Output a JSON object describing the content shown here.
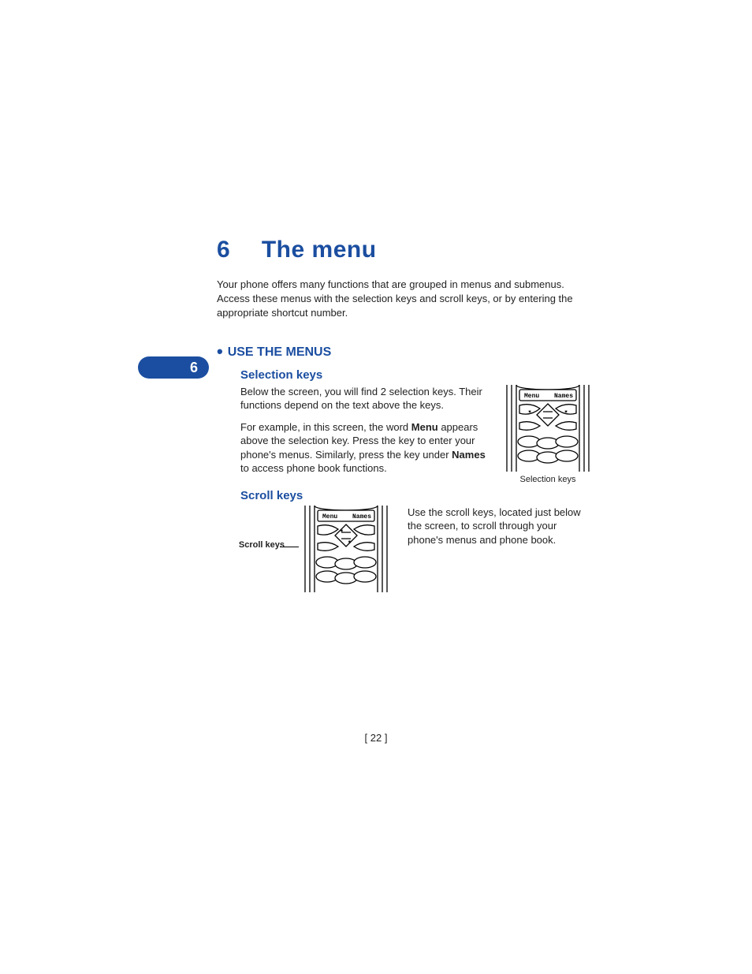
{
  "chapter": {
    "number": "6",
    "title": "The menu"
  },
  "intro": "Your phone offers many functions that are grouped in menus and submenus. Access these menus with the selection keys and scroll keys, or by entering the appropriate shortcut number.",
  "section": {
    "heading": "USE THE MENUS",
    "selection": {
      "heading": "Selection keys",
      "para1": "Below the screen, you will find 2 selection keys. Their functions depend on the text above the keys.",
      "para2_pre": "For example, in this screen, the word ",
      "para2_bold1": "Menu",
      "para2_mid": " appears above the selection key. Press the key to enter your phone's menus. Similarly, press the key under ",
      "para2_bold2": "Names",
      "para2_post": " to access phone book functions.",
      "caption": "Selection keys",
      "fig_menu_label": "Menu",
      "fig_names_label": "Names"
    },
    "scroll": {
      "heading": "Scroll keys",
      "pointer_label": "Scroll keys",
      "para": "Use the scroll keys, located just below the screen, to scroll through your phone's menus and phone book.",
      "fig_menu_label": "Menu",
      "fig_names_label": "Names"
    }
  },
  "side_tab": "6",
  "page_number": "[ 22 ]"
}
